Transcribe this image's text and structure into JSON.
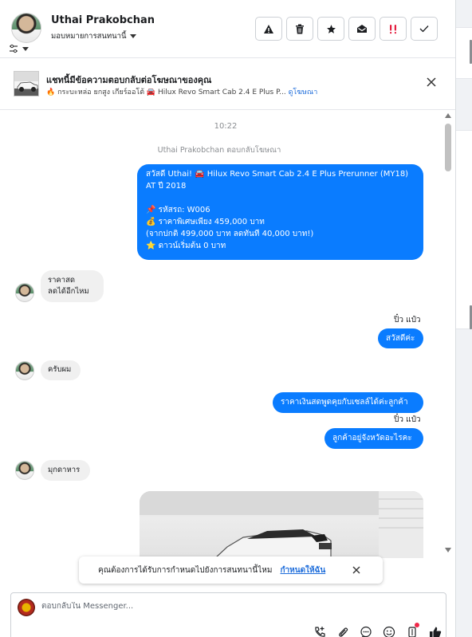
{
  "header": {
    "name": "Uthai Prakobchan",
    "assign_label": "มอบหมายการสนทนานี้"
  },
  "ad_banner": {
    "title": "แชทนี้มีข้อความตอบกลับต่อโฆษณาของคุณ",
    "subtitle_part1": "🔥 กระบะหล่อ ยกสูง เกียร์ออโต้ 🚘 Hilux Revo Smart Cab 2.4 E Plus P...",
    "view_ad_link": "ดูโฆษณา"
  },
  "chat": {
    "time": "10:22",
    "replied_note": "Uthai Prakobchan ตอบกลับโฆษณา",
    "messages": [
      {
        "lines": [
          "สวัสดี Uthai! 🚘 Hilux Revo Smart Cab 2.4 E Plus Prerunner (MY18)",
          "AT ปี 2018",
          "",
          "📌 รหัสรถ: W006",
          "💰 ราคาพิเศษเพียง 459,000 บาท",
          "(จากปกติ 499,000 บาท ลดทันที 40,000 บาท!)",
          "⭐ ดาวน์เริ่มต้น 0 บาท"
        ]
      },
      {
        "text": "ราคาสด\nลดได้อีกไหม"
      },
      {
        "sender": "ปิ๋ว แป๋ว"
      },
      {
        "text": "สวัสดีค่ะ"
      },
      {
        "text": "ครับผม"
      },
      {
        "text": "ราคาเงินสดพูดคุยกับเซลล์ได้ค่ะลูกค้า"
      },
      {
        "sender": "ปิ๋ว แป๋ว"
      },
      {
        "text": "ลูกค้าอยู่จังหวัดอะไรคะ"
      },
      {
        "text": "มุกดาหาร"
      }
    ]
  },
  "toast": {
    "text": "คุณต้องการได้รับการกำหนดไปยังการสนทนานี้ไหม",
    "link": "กำหนดให้ฉัน"
  },
  "composer": {
    "placeholder": "ตอบกลับใน Messenger..."
  },
  "colors": {
    "outgoing": "#0a7cff",
    "incoming": "#f0f0f0",
    "link": "#216fdb",
    "alert": "#e41e3f"
  }
}
